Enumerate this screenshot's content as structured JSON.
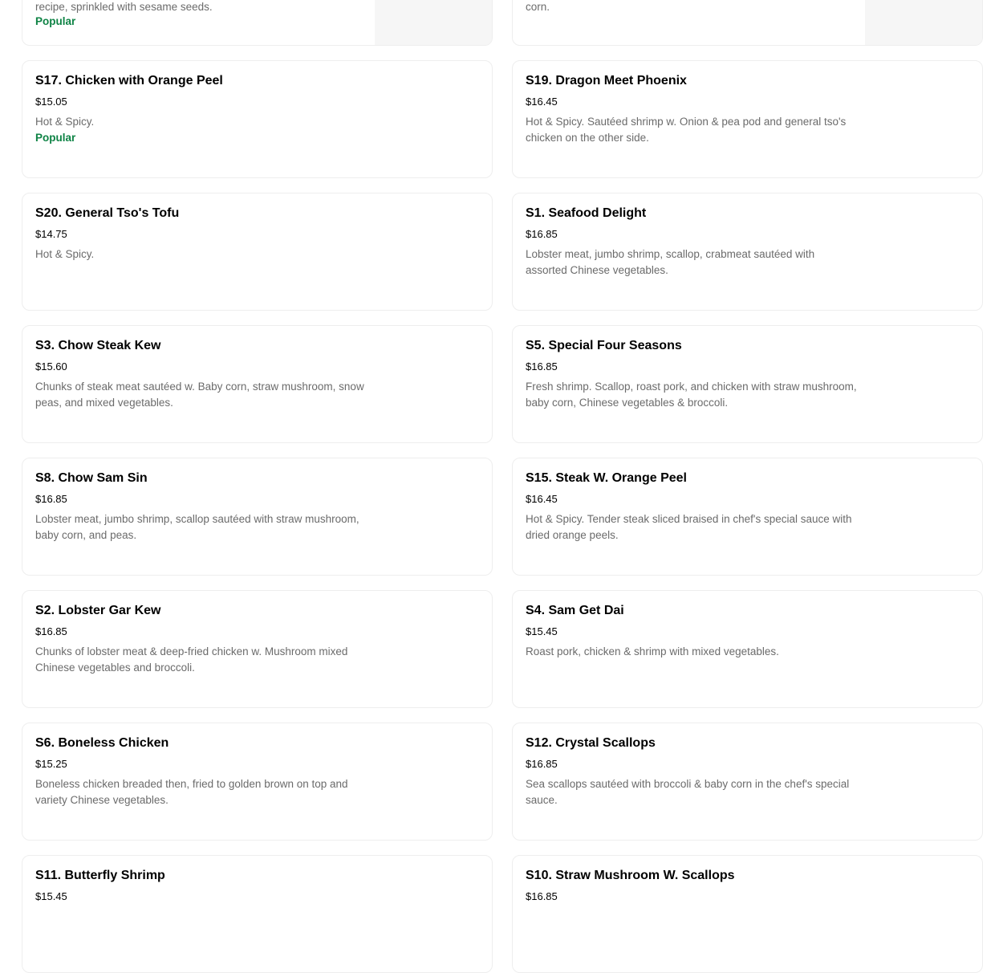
{
  "colors": {
    "popular": "#0e8345",
    "description": "#6b6b6b",
    "border": "#eeeeee"
  },
  "partial_top": [
    {
      "description_tail": "recipe, sprinkled with sesame seeds.",
      "badge": "Popular"
    },
    {
      "description_tail": "corn."
    }
  ],
  "items": [
    {
      "name": "S17. Chicken with Orange Peel",
      "price": "$15.05",
      "description": "Hot & Spicy.",
      "badge": "Popular"
    },
    {
      "name": "S19. Dragon Meet Phoenix",
      "price": "$16.45",
      "description": "Hot & Spicy. Sautéed shrimp w. Onion & pea pod and general tso's chicken on the other side."
    },
    {
      "name": "S20. General Tso's Tofu",
      "price": "$14.75",
      "description": "Hot & Spicy."
    },
    {
      "name": "S1. Seafood Delight",
      "price": "$16.85",
      "description": "Lobster meat, jumbo shrimp, scallop, crabmeat sautéed with assorted Chinese vegetables."
    },
    {
      "name": "S3. Chow Steak Kew",
      "price": "$15.60",
      "description": "Chunks of steak meat sautéed w. Baby corn, straw mushroom, snow peas, and mixed vegetables."
    },
    {
      "name": "S5. Special Four Seasons",
      "price": "$16.85",
      "description": "Fresh shrimp. Scallop, roast pork, and chicken with straw mushroom, baby corn, Chinese vegetables & broccoli."
    },
    {
      "name": "S8. Chow Sam Sin",
      "price": "$16.85",
      "description": "Lobster meat, jumbo shrimp, scallop sautéed with straw mushroom, baby corn, and peas."
    },
    {
      "name": "S15. Steak W. Orange Peel",
      "price": "$16.45",
      "description": "Hot & Spicy. Tender steak sliced braised in chef's special sauce with dried orange peels."
    },
    {
      "name": "S2. Lobster Gar Kew",
      "price": "$16.85",
      "description": "Chunks of lobster meat & deep-fried chicken w. Mushroom mixed Chinese vegetables and broccoli."
    },
    {
      "name": "S4. Sam Get Dai",
      "price": "$15.45",
      "description": "Roast pork, chicken & shrimp with mixed vegetables."
    },
    {
      "name": "S6. Boneless Chicken",
      "price": "$15.25",
      "description": "Boneless chicken breaded then, fried to golden brown on top and variety Chinese vegetables."
    },
    {
      "name": "S12. Crystal Scallops",
      "price": "$16.85",
      "description": "Sea scallops sautéed with broccoli & baby corn in the chef's special sauce."
    },
    {
      "name": "S11. Butterfly Shrimp",
      "price": "$15.45"
    },
    {
      "name": "S10. Straw Mushroom W. Scallops",
      "price": "$16.85"
    }
  ]
}
